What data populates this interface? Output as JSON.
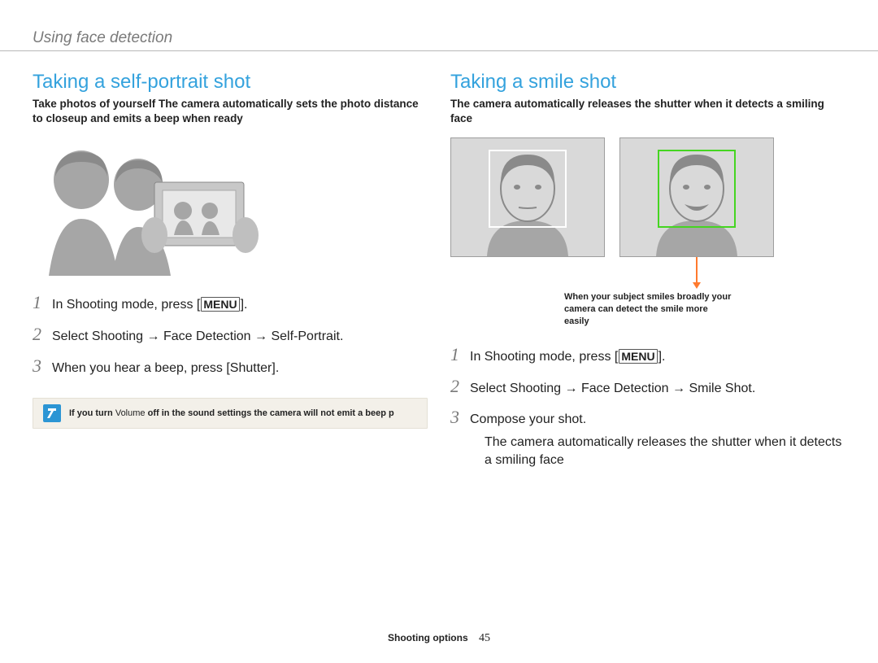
{
  "header": {
    "breadcrumb": "Using face detection"
  },
  "left": {
    "title": "Taking a self-portrait shot",
    "intro": "Take photos of yourself The camera automatically sets the photo distance to closeup and emits a beep when ready",
    "steps": {
      "s1_pre": "In Shooting mode, press [",
      "menu": "MENU",
      "s1_post": "].",
      "s2": "Select Shooting → Face Detection → Self-Portrait.",
      "s3": "When you hear a beep, press [Shutter]."
    },
    "note_pre": "If you turn",
    "note_mid": " Volume ",
    "note_post": "off in the sound settings the camera will not emit a beep p"
  },
  "right": {
    "title": "Taking a smile shot",
    "intro": "The camera automatically releases the shutter when it detects a smiling face",
    "caption": "When your subject smiles broadly your camera can detect the smile more easily",
    "steps": {
      "s1_pre": "In Shooting mode, press [",
      "menu": "MENU",
      "s1_post": "].",
      "s2": "Select Shooting → Face Detection → Smile Shot.",
      "s3": "Compose your shot.",
      "bullet1": "The camera automatically releases the shutter when it detects a smiling face"
    }
  },
  "footer": {
    "section": "Shooting options",
    "page": "45"
  }
}
